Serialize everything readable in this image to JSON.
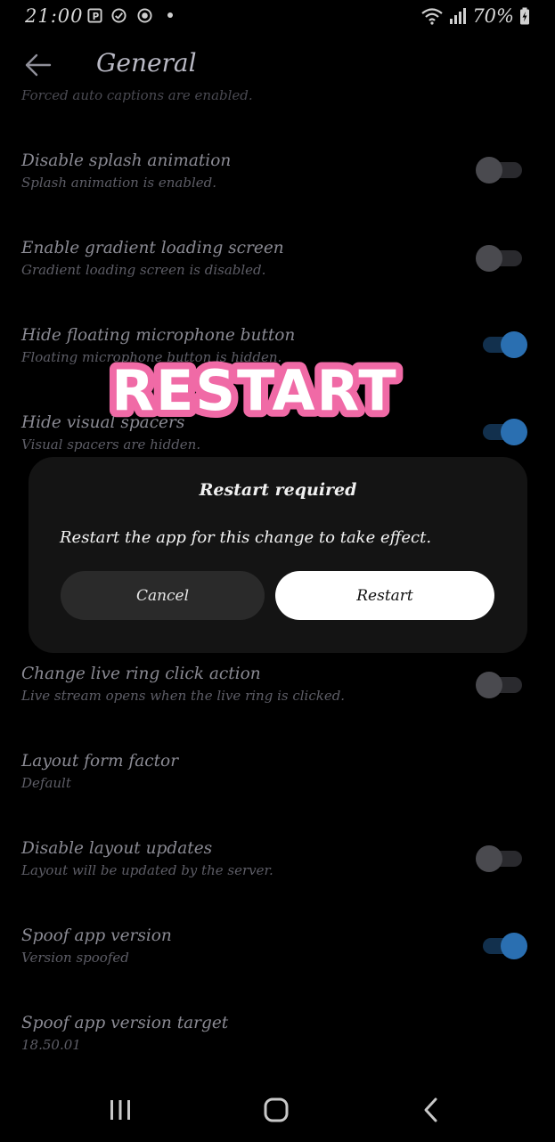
{
  "status_bar": {
    "time": "21:00",
    "battery": "70%",
    "icons": [
      "notification-p-icon",
      "check-circle-icon",
      "record-circle-icon",
      "wifi-icon",
      "signal-icon",
      "battery-charging-icon"
    ]
  },
  "app_bar": {
    "title": "General",
    "back_icon": "arrow-left-icon"
  },
  "settings": {
    "cut_summary": "Forced auto captions are enabled.",
    "rows": [
      {
        "title": "Disable splash animation",
        "summary": "Splash animation is enabled.",
        "toggle": "off"
      },
      {
        "title": "Enable gradient loading screen",
        "summary": "Gradient loading screen is disabled.",
        "toggle": "off"
      },
      {
        "title": "Hide floating microphone button",
        "summary": "Floating microphone button is hidden.",
        "toggle": "on"
      },
      {
        "title": "Hide visual spacers",
        "summary": "Visual spacers are hidden.",
        "toggle": "on"
      },
      {
        "title": "Change live ring click action",
        "summary": "Live stream opens when the live ring is clicked.",
        "toggle": "off"
      },
      {
        "title": "Layout form factor",
        "summary": "Default"
      },
      {
        "title": "Disable layout updates",
        "summary": "Layout will be updated by the server.",
        "toggle": "off"
      },
      {
        "title": "Spoof app version",
        "summary": "Version spoofed",
        "toggle": "on"
      },
      {
        "title": "Spoof app version target",
        "summary": "18.50.01"
      }
    ]
  },
  "dialog": {
    "title": "Restart required",
    "message": "Restart the app for this change to take effect.",
    "cancel_label": "Cancel",
    "confirm_label": "Restart"
  },
  "sticker": {
    "text": "RESTART",
    "fill": "#ffffff",
    "outline": "#f06aa6"
  },
  "nav_bar": {
    "icons": [
      "recents-icon",
      "home-icon",
      "back-icon"
    ]
  },
  "colors": {
    "toggle_on": "#2a6fb1",
    "toggle_off": "#4a4a4f",
    "dialog_bg": "#141414"
  }
}
